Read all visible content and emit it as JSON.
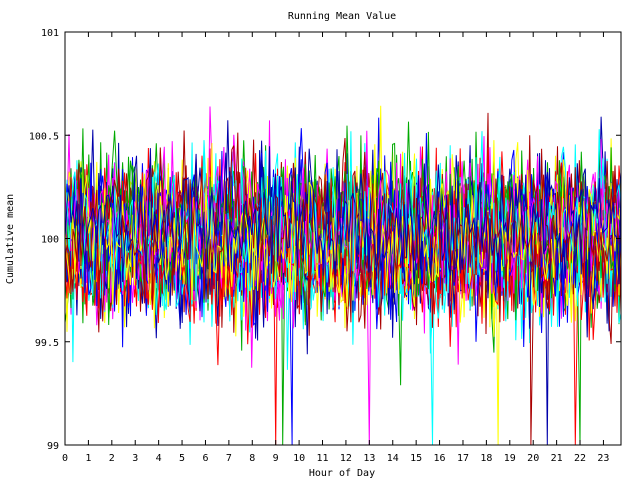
{
  "chart_data": {
    "type": "line",
    "title": "Running Mean Value",
    "xlabel": "Hour of Day",
    "ylabel": "Cumulative mean",
    "xlim": [
      0,
      23.75
    ],
    "ylim": [
      99,
      101
    ],
    "x_ticks": [
      0,
      1,
      2,
      3,
      4,
      5,
      6,
      7,
      8,
      9,
      10,
      11,
      12,
      13,
      14,
      15,
      16,
      17,
      18,
      19,
      20,
      21,
      22,
      23
    ],
    "y_ticks": [
      99,
      99.5,
      100,
      100.5,
      101
    ],
    "y_tick_labels": [
      "99",
      "99.5",
      "100",
      "100.5",
      "101"
    ],
    "grid": false,
    "legend": "none",
    "series_style": {
      "count": 48,
      "center": 100,
      "typical_spread": 0.2,
      "colors": [
        "#ff0000",
        "#00aa00",
        "#0000ff",
        "#ff00ff",
        "#00ffff",
        "#ffff00",
        "#aa0000",
        "#0000aa"
      ]
    },
    "notable_spikes": [
      {
        "x": 9.0,
        "y": 99.0
      },
      {
        "x": 9.3,
        "y": 99.0
      },
      {
        "x": 9.7,
        "y": 99.0
      },
      {
        "x": 13.0,
        "y": 99.0
      },
      {
        "x": 15.7,
        "y": 99.0
      },
      {
        "x": 18.5,
        "y": 99.0
      },
      {
        "x": 19.9,
        "y": 99.0
      },
      {
        "x": 20.6,
        "y": 99.0
      },
      {
        "x": 21.8,
        "y": 99.0
      },
      {
        "x": 22.0,
        "y": 99.0
      }
    ]
  }
}
